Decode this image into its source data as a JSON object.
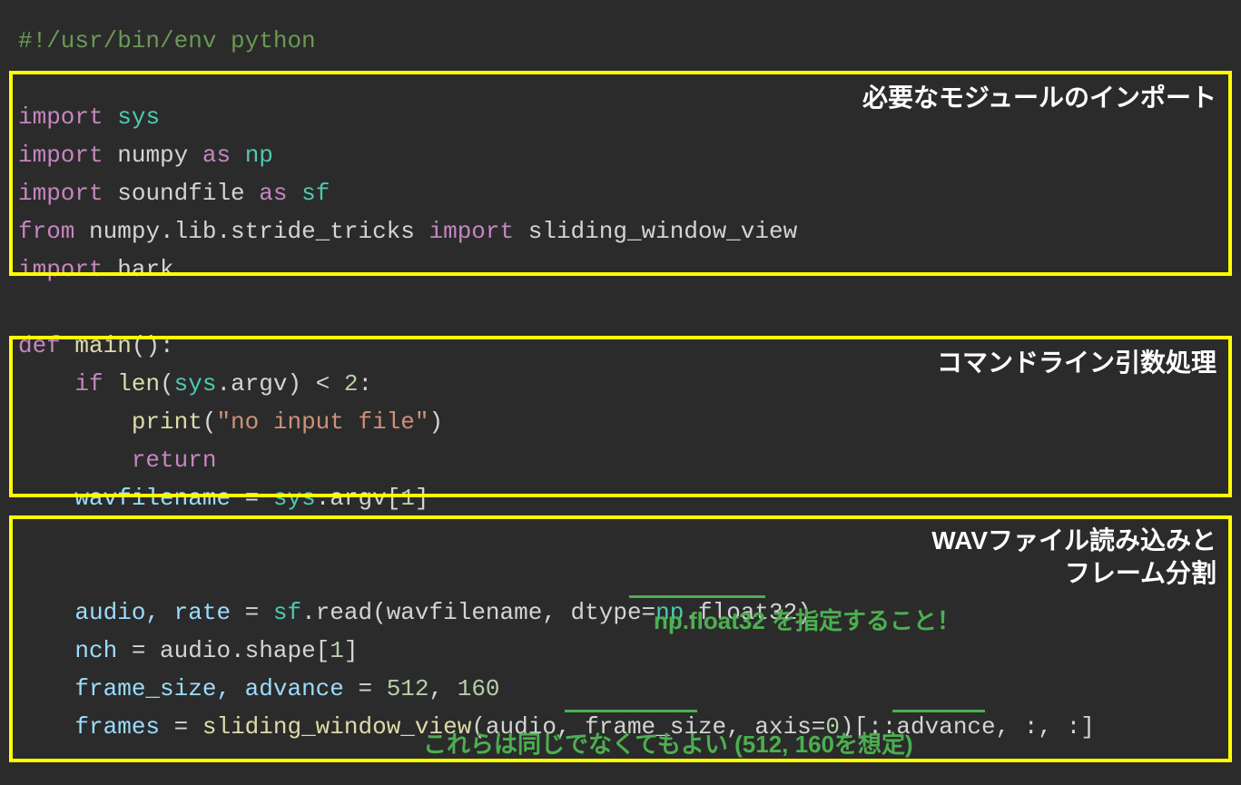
{
  "code": {
    "shebang": "#!/usr/bin/env python",
    "imp1_kw": "import",
    "imp1_mod": "sys",
    "imp2_kw": "import",
    "imp2_mod": "numpy",
    "imp2_as": "as",
    "imp2_alias": "np",
    "imp3_kw": "import",
    "imp3_mod": "soundfile",
    "imp3_as": "as",
    "imp3_alias": "sf",
    "imp4_from": "from",
    "imp4_mod": "numpy.lib.stride_tricks",
    "imp4_import": "import",
    "imp4_name": "sliding_window_view",
    "imp5_kw": "import",
    "imp5_mod": "hark",
    "def_kw": "def",
    "def_name": "main",
    "def_paren": "():",
    "if_kw": "if",
    "if_indent": "    ",
    "if_len": "len",
    "if_sys": "sys",
    "if_argv": ".argv",
    "if_cmp": ") < ",
    "if_num": "2",
    "if_colon": ":",
    "print_indent": "        ",
    "print_fn": "print",
    "print_paren_open": "(",
    "print_str": "\"no input file\"",
    "print_paren_close": ")",
    "ret_indent": "        ",
    "ret_kw": "return",
    "wav_indent": "    ",
    "wav_var": "wavfilename",
    "wav_eq": " = ",
    "wav_sys": "sys",
    "wav_argv": ".argv[",
    "wav_idx": "1",
    "wav_close": "]",
    "audio_indent": "    ",
    "audio_vars": "audio, rate",
    "audio_eq": " = ",
    "audio_sf": "sf",
    "audio_read": ".read(wavfilename, dtype=",
    "audio_np": "np",
    "audio_float": ".float32)",
    "nch_indent": "    ",
    "nch_var": "nch",
    "nch_eq": " = ",
    "nch_expr": "audio.shape[",
    "nch_idx": "1",
    "nch_close": "]",
    "fs_indent": "    ",
    "fs_vars": "frame_size, advance",
    "fs_eq": " = ",
    "fs_v1": "512",
    "fs_comma": ", ",
    "fs_v2": "160",
    "fr_indent": "    ",
    "fr_var": "frames",
    "fr_eq": " = ",
    "fr_fn": "sliding_window_view",
    "fr_args": "(audio, frame_size, axis=",
    "fr_axis": "0",
    "fr_slice": ")[::advance, :, :]"
  },
  "labels": {
    "box1": "必要なモジュールのインポート",
    "box2": "コマンドライン引数処理",
    "box3_line1": "WAVファイル読み込みと",
    "box3_line2": "フレーム分割"
  },
  "notes": {
    "float32": "np.float32 を指定すること！",
    "same": "これらは同じでなくてもよい (512, 160を想定)"
  }
}
